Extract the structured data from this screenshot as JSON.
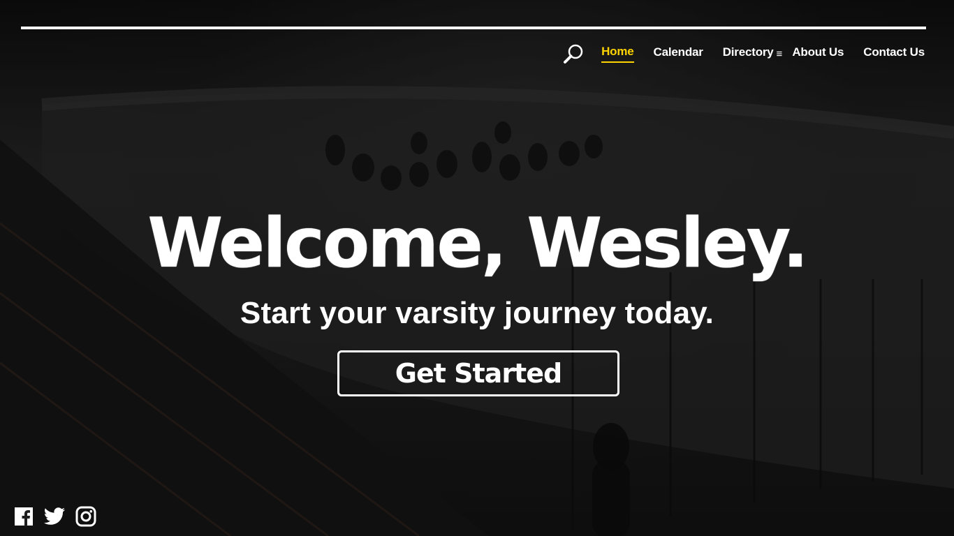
{
  "nav": {
    "items": [
      {
        "label": "Home",
        "active": true
      },
      {
        "label": "Calendar",
        "active": false
      },
      {
        "label": "Directory",
        "active": false
      },
      {
        "label": "About Us",
        "active": false
      },
      {
        "label": "Contact Us",
        "active": false
      }
    ],
    "search_icon": "search-icon",
    "directory_menu_icon": "hamburger-icon",
    "menu_glyph": "≡"
  },
  "hero": {
    "headline": "Welcome, Wesley.",
    "subheadline": "Start your varsity journey today.",
    "cta_label": "Get Started"
  },
  "social": {
    "icons": [
      "facebook-icon",
      "twitter-icon",
      "instagram-icon"
    ]
  },
  "colors": {
    "accent": "#ffd400",
    "text": "#ffffff",
    "overlay": "#1e1e1e"
  }
}
